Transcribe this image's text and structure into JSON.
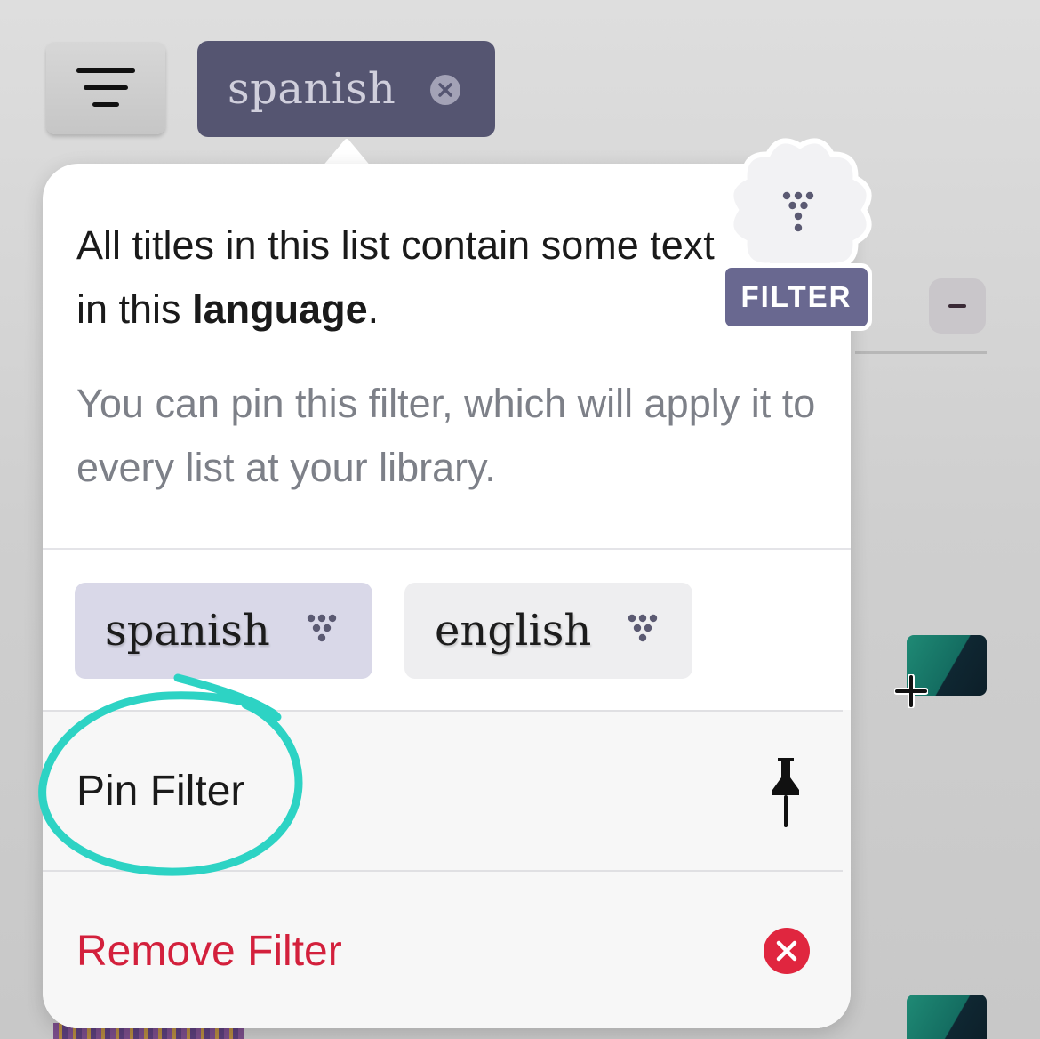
{
  "toolbar": {
    "menu_icon": "hamburger-menu-icon",
    "active_filter": {
      "label": "spanish",
      "clear_icon": "clear-circle-icon"
    },
    "collapse_icon": "minus-icon",
    "add_icon": "plus-icon"
  },
  "popover": {
    "info_prefix": "All titles in this list contain some text in this ",
    "info_emphasis": "language",
    "info_suffix": ".",
    "help_text": "You can pin this filter, which will apply it to every list at your library.",
    "badge": {
      "label": "FILTER",
      "icon": "filter-funnel-icon"
    },
    "languages": [
      {
        "label": "spanish",
        "selected": true,
        "icon": "filter-funnel-icon"
      },
      {
        "label": "english",
        "selected": false,
        "icon": "filter-funnel-icon"
      }
    ],
    "actions": {
      "pin": {
        "label": "Pin Filter",
        "icon": "pushpin-icon"
      },
      "remove": {
        "label": "Remove Filter",
        "icon": "remove-circle-icon"
      }
    }
  },
  "colors": {
    "chip_active": "#555571",
    "badge": "#696890",
    "chip_selected": "#d9d8e8",
    "destructive": "#d3203c",
    "annotation": "#2dd3c4"
  }
}
